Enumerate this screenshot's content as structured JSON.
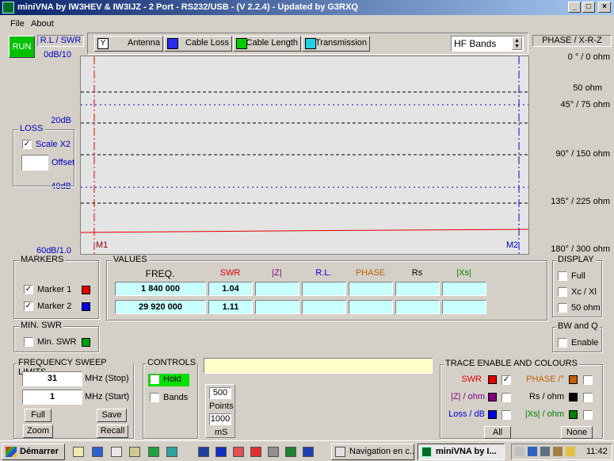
{
  "window": {
    "title": "miniVNA by IW3HEV & IW3IJZ - 2 Port - RS232/USB -  (V 2.2.4) - Updated by G3RXQ",
    "minimize": "_",
    "maximize": "□",
    "close": "×"
  },
  "menu": {
    "file": "File",
    "about": "About"
  },
  "toolbar": {
    "run": "RUN",
    "rl_swr": "R.L / SWR",
    "modes": [
      "Antenna",
      "Cable Loss",
      "Cable Length",
      "Transmission"
    ],
    "band_select": "HF Bands",
    "phase_title": "PHASE / X-R-Z"
  },
  "left_axis": [
    "0dB/10",
    "20dB",
    "40dB",
    "60dB/1.0"
  ],
  "right_axis": [
    "0 ° / 0 ohm",
    "50 ohm",
    "45° / 75 ohm",
    "90° / 150 ohm",
    "135° / 225 ohm",
    "180° / 300 ohm"
  ],
  "plot": {
    "m1": "M1",
    "m2": "M2"
  },
  "loss": {
    "title": "LOSS",
    "scale_label": "Scale X2",
    "scale_checked": "✓",
    "offset_label": "Offset",
    "offset_value": ""
  },
  "markers": {
    "title": "MARKERS",
    "m1_label": "Marker 1",
    "m1_checked": "✓",
    "m2_label": "Marker 2",
    "m2_checked": "✓"
  },
  "values": {
    "title": "VALUES",
    "headers": [
      "FREQ.",
      "SWR",
      "|Z|",
      "R.L.",
      "PHASE",
      "Rs",
      "|Xs|"
    ],
    "rows": [
      [
        "1 840 000",
        "1.04",
        "",
        "",
        "",
        "",
        ""
      ],
      [
        "29 920 000",
        "1.11",
        "",
        "",
        "",
        "",
        ""
      ]
    ]
  },
  "display": {
    "title": "DISPLAY",
    "full": "Full",
    "xcxl": "Xc / Xl",
    "ohm50": "50 ohm"
  },
  "min_swr": {
    "title": "MIN. SWR",
    "label": "Min. SWR"
  },
  "bwq": {
    "title": "BW and Q",
    "label": "Enable"
  },
  "sweep": {
    "title": "FREQUENCY SWEEP LIMITS",
    "stop_value": "31",
    "stop_label": "MHz  (Stop)",
    "start_value": "1",
    "start_label": "MHz  (Start)",
    "full": "Full",
    "save": "Save",
    "zoom": "Zoom",
    "recall": "Recall"
  },
  "controls": {
    "title": "CONTROLS",
    "hold": "Hold",
    "bands": "Bands",
    "points_value": "500",
    "points_label": "Points",
    "ms_value": "1000",
    "ms_label": "mS"
  },
  "trace": {
    "title": "TRACE ENABLE AND COLOURS",
    "swr": "SWR",
    "swr_checked": "✓",
    "z": "|Z| / ohm",
    "loss": "Loss / dB",
    "phase": "PHASE /°",
    "rs": "Rs / ohm",
    "xs": "|Xs| / ohm",
    "all": "All",
    "none": "None"
  },
  "taskbar": {
    "start": "Démarrer",
    "task1": "Navigation en c...",
    "task2": "miniVNA by I...",
    "clock": "11:42"
  },
  "colors": {
    "swr": "#e00000",
    "z": "#800080",
    "loss": "#0000e0",
    "phase": "#c06000",
    "rs": "#000000",
    "xs": "#008000",
    "marker1": "#e00000",
    "marker2": "#0000e0",
    "min_swr": "#00a000"
  }
}
